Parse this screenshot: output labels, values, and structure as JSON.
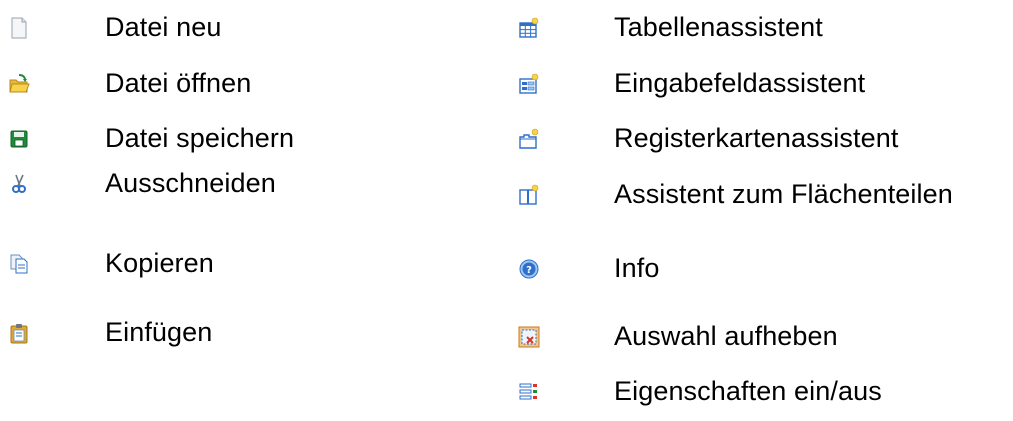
{
  "left_column": {
    "items": [
      {
        "icon": "new-file-icon",
        "label": "Datei neu"
      },
      {
        "icon": "open-folder-icon",
        "label": "Datei öffnen"
      },
      {
        "icon": "save-disk-icon",
        "label": "Datei speichern"
      },
      {
        "icon": "scissors-cut-icon",
        "label": "Ausschneiden"
      },
      {
        "icon": "copy-icon",
        "label": "Kopieren"
      },
      {
        "icon": "paste-clipboard-icon",
        "label": "Einfügen"
      }
    ]
  },
  "right_column": {
    "items": [
      {
        "icon": "table-wizard-icon",
        "label": "Tabellenassistent"
      },
      {
        "icon": "input-field-wizard-icon",
        "label": "Eingabefeldassistent"
      },
      {
        "icon": "tab-wizard-icon",
        "label": "Registerkartenassistent"
      },
      {
        "icon": "split-area-wizard-icon",
        "label": "Assistent zum Flächenteilen"
      },
      {
        "icon": "info-help-icon",
        "label": "Info"
      },
      {
        "icon": "deselect-icon",
        "label": "Auswahl aufheben"
      },
      {
        "icon": "properties-toggle-icon",
        "label": "Eigenschaften ein/aus"
      }
    ]
  },
  "colors": {
    "text": "#000000",
    "icon_blue": "#2f6fc9",
    "icon_light_blue": "#9cc6f2",
    "icon_yellow": "#f7d34a",
    "icon_green": "#1f8a3a",
    "icon_red": "#d9332b"
  }
}
